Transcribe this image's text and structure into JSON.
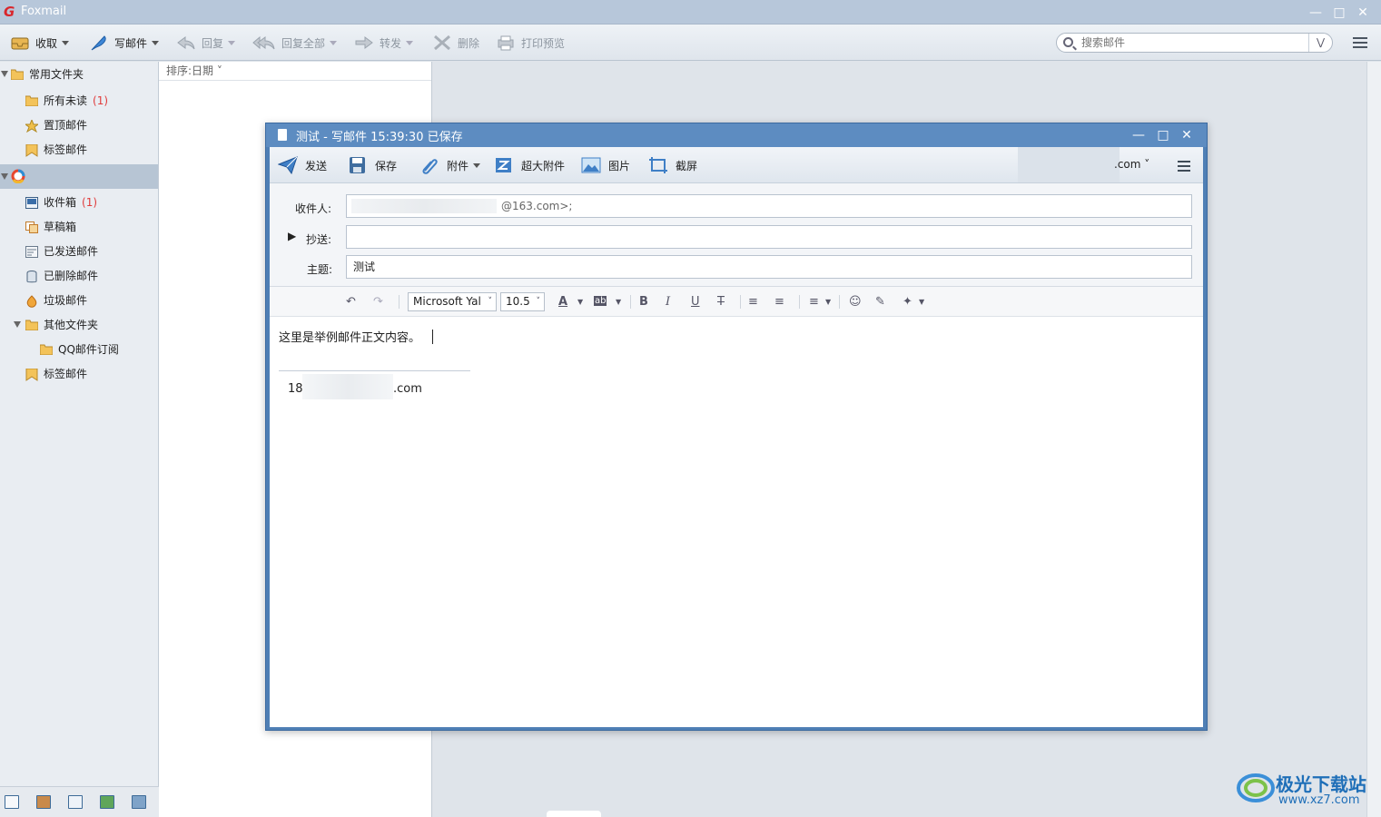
{
  "app": {
    "title": "Foxmail"
  },
  "toolbar": {
    "receive": "收取",
    "compose": "写邮件",
    "reply": "回复",
    "reply_all": "回复全部",
    "forward": "转发",
    "delete": "删除",
    "print_preview": "打印预览",
    "search_placeholder": "搜索邮件"
  },
  "sidebar": {
    "common_folder": "常用文件夹",
    "all_unread": "所有未读",
    "all_unread_count": "(1)",
    "pinned": "置顶邮件",
    "tagged": "标签邮件",
    "inbox": "收件箱",
    "inbox_count": "(1)",
    "drafts": "草稿箱",
    "sent": "已发送邮件",
    "deleted": "已删除邮件",
    "junk": "垃圾邮件",
    "other_folders": "其他文件夹",
    "qq_subscription": "QQ邮件订阅",
    "tagged2": "标签邮件"
  },
  "list": {
    "sort_label": "排序:日期"
  },
  "compose": {
    "title": "测试 - 写邮件    15:39:30 已保存",
    "send": "发送",
    "save": "保存",
    "attach": "附件",
    "big_attach": "超大附件",
    "image": "图片",
    "screenshot": "截屏",
    "account_suffix": ".com",
    "to_label": "收件人:",
    "to_value": "@163.com>;",
    "cc_label": "抄送:",
    "cc_value": "",
    "subject_label": "主题:",
    "subject_value": "测试",
    "font_name": "Microsoft Yal",
    "font_size": "10.5",
    "body_text": "这里是举例邮件正文内容。",
    "signature_prefix": "18",
    "signature_suffix": ".com"
  },
  "watermark": {
    "brand": "极光下载站",
    "url": "www.xz7.com"
  },
  "colors": {
    "accent": "#4f7fb5",
    "unread": "#e03c3c",
    "titlebar": "#b7c7da"
  }
}
